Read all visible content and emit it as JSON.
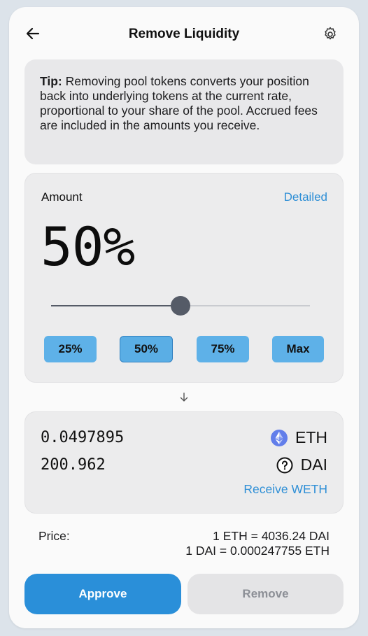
{
  "header": {
    "title": "Remove Liquidity",
    "back_icon": "arrow-left-icon",
    "settings_icon": "gear-icon"
  },
  "tip": {
    "label": "Tip:",
    "text": " Removing pool tokens converts your position back into underlying tokens at the current rate, proportional to your share of the pool. Accrued fees are included in the amounts you receive."
  },
  "amount": {
    "label": "Amount",
    "detailed_link": "Detailed",
    "percent_display": "50%",
    "slider_value": 0.5,
    "presets": [
      "25%",
      "50%",
      "75%",
      "Max"
    ],
    "selected_preset": "50%"
  },
  "output": {
    "rows": [
      {
        "amount": "0.0497895",
        "symbol": "ETH",
        "icon": "ethereum-icon"
      },
      {
        "amount": "200.962",
        "symbol": "DAI",
        "icon": "unknown-token-icon"
      }
    ],
    "receive_link": "Receive WETH"
  },
  "price": {
    "label": "Price:",
    "line1": "1 ETH = 4036.24 DAI",
    "line2": "1 DAI = 0.000247755 ETH"
  },
  "actions": {
    "approve_label": "Approve",
    "remove_label": "Remove"
  },
  "colors": {
    "accent": "#2a8fd9",
    "preset_button": "#5eb1e8",
    "link": "#2f8fd6",
    "slider_thumb": "#555b67"
  }
}
